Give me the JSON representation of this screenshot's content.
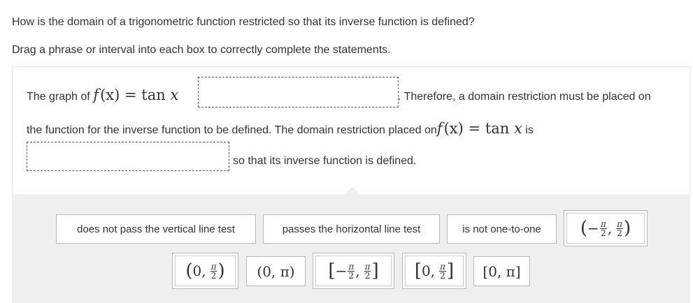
{
  "question": "How is the domain of a trigonometric function restricted so that its inverse function is defined?",
  "instruction": "Drag a phrase or interval into each box to correctly complete the statements.",
  "statement": {
    "line1_prefix": "The graph of",
    "line1_suffix": ". Therefore, a domain restriction must be placed on",
    "line2": "the function for the inverse function to be defined. The domain restriction placed on",
    "line2_suffix": "is",
    "line3_suffix": "so that its inverse function is defined.",
    "function_expr": {
      "f": "f",
      "arg": "(x)",
      "eq": "=",
      "fn": "tan",
      "var": "x"
    }
  },
  "tiles": {
    "phrase_1": "does not pass the vertical line test",
    "phrase_2": "passes the horizontal line test",
    "phrase_3": "is not one-to-one",
    "interval_open_neg_pi2_pi2": {
      "lp": "(",
      "neg": "−",
      "num": "π",
      "den": "2",
      "rp": ")"
    },
    "interval_open_0_pi2": {
      "lp": "(",
      "zero": "0,",
      "num": "π",
      "den": "2",
      "rp": ")"
    },
    "interval_open_0_pi": "(0, π)",
    "interval_closed_neg_pi2_pi2": {
      "lp": "[",
      "neg": "−",
      "num": "π",
      "den": "2",
      "rp": "]"
    },
    "interval_closed_0_pi2": {
      "lp": "[",
      "zero": "0,",
      "num": "π",
      "den": "2",
      "rp": "]"
    },
    "interval_closed_0_pi": "[0, π]"
  },
  "colors": {
    "text": "#333333",
    "tray_background": "#efefef",
    "tile_border": "#b8b8b8",
    "drop_border": "#555555"
  }
}
